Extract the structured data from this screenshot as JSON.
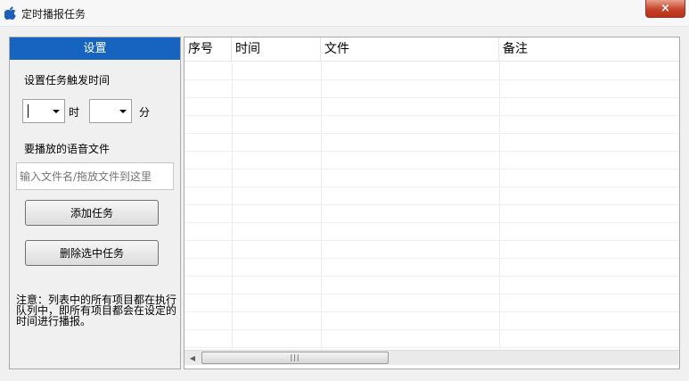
{
  "window": {
    "title": "定时播报任务",
    "close_glyph": "×",
    "app_icon": "apple-icon"
  },
  "settings": {
    "header": "设置",
    "trigger_label": "设置任务触发时间",
    "hour_value": "",
    "hour_unit": "时",
    "minute_value": "",
    "minute_unit": "分",
    "audio_label": "要播放的语音文件",
    "file_placeholder": "输入文件名/拖放文件到这里",
    "add_button": "添加任务",
    "delete_button": "删除选中任务",
    "note": "注意：列表中的所有项目都在执行队列中，即所有项目都会在设定的时间进行播报。"
  },
  "task_list": {
    "columns": [
      "序号",
      "时间",
      "文件",
      "备注"
    ],
    "rows": []
  },
  "scrollbar": {
    "left_arrow_glyph": "◀",
    "thumb_grip": "|||"
  },
  "colors": {
    "header_blue": "#1664c0",
    "close_red": "#c7432a"
  }
}
